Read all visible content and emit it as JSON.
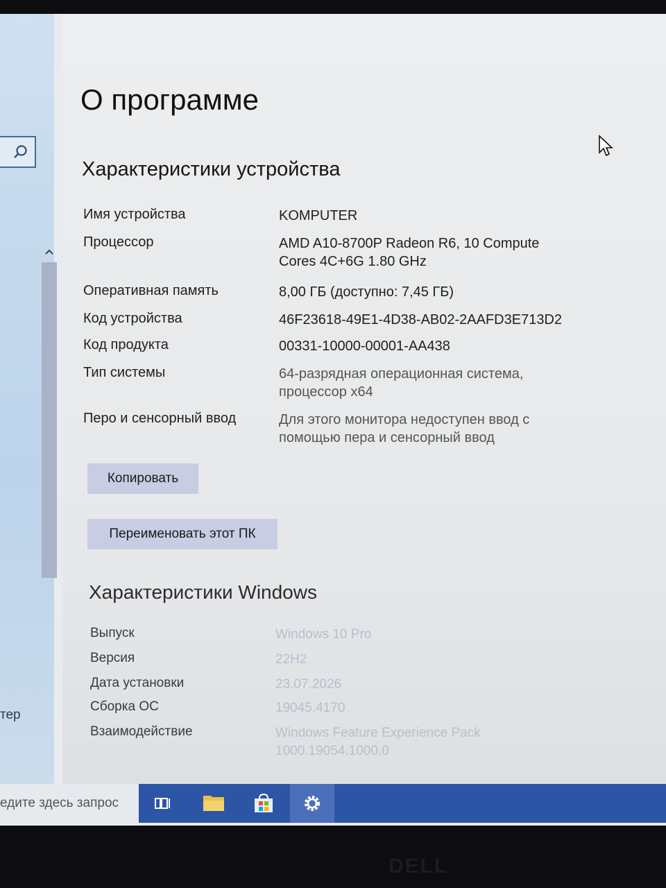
{
  "page": {
    "title": "О программе",
    "device_section_title": "Характеристики устройства",
    "device_specs": [
      {
        "label": "Имя устройства",
        "value": "KOMPUTER"
      },
      {
        "label": "Процессор",
        "value": "AMD A10-8700P Radeon R6, 10 Compute Cores 4C+6G 1.80 GHz"
      },
      {
        "label": "Оперативная память",
        "value": "8,00 ГБ (доступно: 7,45 ГБ)"
      },
      {
        "label": "Код устройства",
        "value": "46F23618-49E1-4D38-AB02-2AAFD3E713D2"
      },
      {
        "label": "Код продукта",
        "value": "00331-10000-00001-AA438"
      },
      {
        "label": "Тип системы",
        "value": "64-разрядная операционная система, процессор x64"
      },
      {
        "label": "Перо и сенсорный ввод",
        "value": "Для этого монитора недоступен ввод с помощью пера и сенсорный ввод"
      }
    ],
    "copy_button": "Копировать",
    "rename_button": "Переименовать этот ПК",
    "windows_section_title": "Характеристики Windows",
    "windows_specs": [
      {
        "label": "Выпуск",
        "value": "Windows 10 Pro"
      },
      {
        "label": "Версия",
        "value": "22H2"
      },
      {
        "label": "Дата установки",
        "value": "23.07.2026"
      },
      {
        "label": "Сборка ОС",
        "value": "19045.4170"
      },
      {
        "label": "Взаимодействие",
        "value": "Windows Feature Experience Pack 1000.19054.1000.0"
      }
    ]
  },
  "sidebar": {
    "stub_text": "тер"
  },
  "taskbar": {
    "search_placeholder": "едите здесь запрос",
    "icons": [
      "task-view-icon",
      "file-explorer-icon",
      "store-icon",
      "settings-icon"
    ]
  },
  "bezel": {
    "logo": "DELL"
  },
  "colors": {
    "taskbar": "#2d55a6",
    "button": "#c8cde4",
    "scroll_thumb": "#a8b3c8"
  }
}
